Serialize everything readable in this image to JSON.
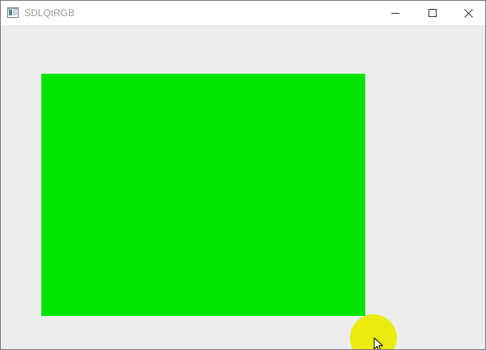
{
  "window": {
    "title": "SDLQtRGB"
  },
  "titlebar": {
    "icons": {
      "app": "app-window-icon",
      "minimize": "minimize-icon",
      "maximize": "maximize-icon",
      "close": "close-icon"
    }
  },
  "canvas": {
    "rect_color": "#00e400",
    "click_indicator_color": "#ebeb10",
    "cursor": "arrow-cursor-icon"
  }
}
